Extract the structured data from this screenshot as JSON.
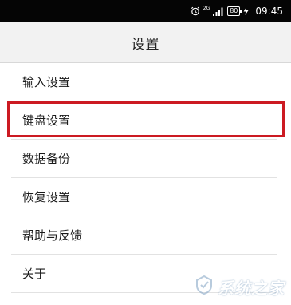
{
  "status_bar": {
    "network": "2G",
    "signal": ".ıll",
    "battery": "80",
    "time": "09:45",
    "icons": [
      "alarm-icon",
      "signal-icon",
      "battery-icon",
      "charging-icon"
    ]
  },
  "header": {
    "title": "设置"
  },
  "menu": {
    "items": [
      {
        "label": "输入设置"
      },
      {
        "label": "键盘设置",
        "highlighted": true
      },
      {
        "label": "数据备份"
      },
      {
        "label": "恢复设置"
      },
      {
        "label": "帮助与反馈"
      },
      {
        "label": "关于"
      }
    ]
  },
  "watermark": {
    "text": "系统之家"
  },
  "colors": {
    "status_bar_bg": "#050505",
    "header_bg": "#f2f2f2",
    "highlight_border": "#cc1a22"
  }
}
